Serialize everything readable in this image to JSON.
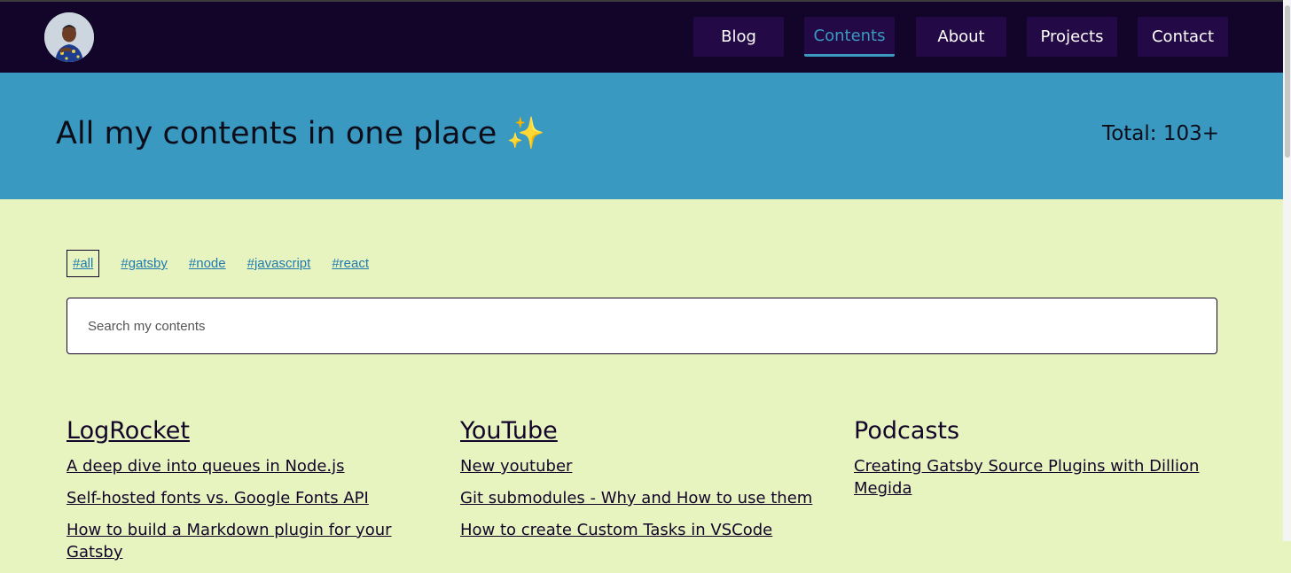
{
  "nav": {
    "items": [
      {
        "label": "Blog",
        "active": false
      },
      {
        "label": "Contents",
        "active": true
      },
      {
        "label": "About",
        "active": false
      },
      {
        "label": "Projects",
        "active": false
      },
      {
        "label": "Contact",
        "active": false
      }
    ]
  },
  "hero": {
    "title": "All my contents in one place ✨",
    "total": "Total: 103+"
  },
  "tags": [
    {
      "label": "#all",
      "active": true
    },
    {
      "label": "#gatsby",
      "active": false
    },
    {
      "label": "#node",
      "active": false
    },
    {
      "label": "#javascript",
      "active": false
    },
    {
      "label": "#react",
      "active": false
    }
  ],
  "search": {
    "placeholder": "Search my contents",
    "value": ""
  },
  "columns": [
    {
      "heading": "LogRocket",
      "heading_is_link": true,
      "items": [
        "A deep dive into queues in Node.js",
        "Self-hosted fonts vs. Google Fonts API",
        "How to build a Markdown plugin for your Gatsby"
      ]
    },
    {
      "heading": "YouTube",
      "heading_is_link": true,
      "items": [
        "New youtuber",
        "Git submodules - Why and How to use them",
        "How to create Custom Tasks in VSCode"
      ]
    },
    {
      "heading": "Podcasts",
      "heading_is_link": false,
      "items": [
        "Creating Gatsby Source Plugins with Dillion Megida"
      ]
    }
  ],
  "colors": {
    "navbar_bg": "#13052a",
    "nav_button_bg": "#230a46",
    "accent": "#3999c1",
    "page_bg": "#e7f4bf",
    "tag_link": "#1f7ab0"
  }
}
